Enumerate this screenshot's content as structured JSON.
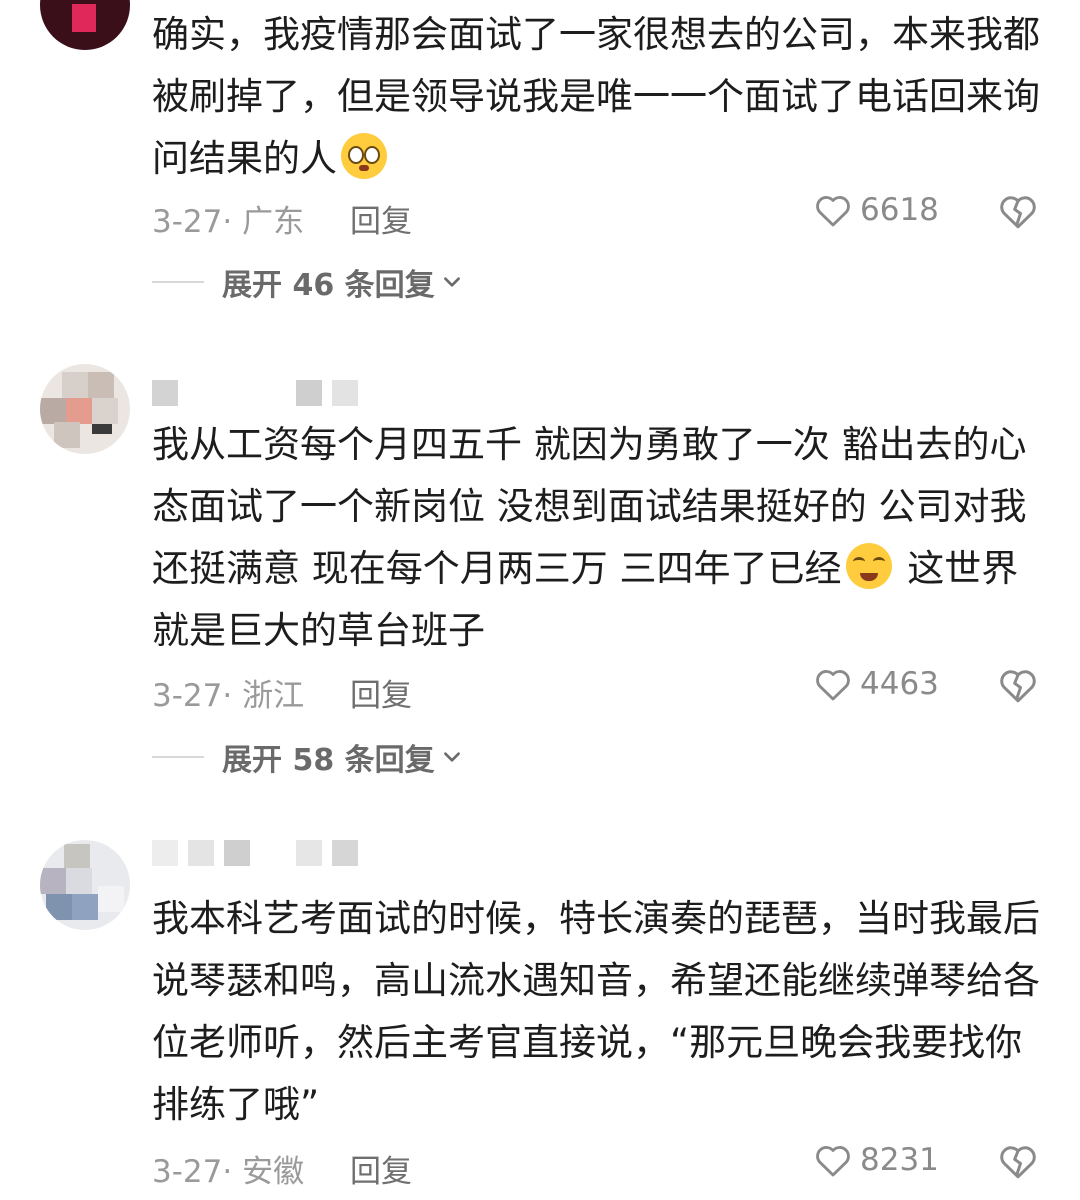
{
  "comments": [
    {
      "text_lines": [
        "确实，我疫情那会面试了一家很想去的公司，本来我都",
        "被刷掉了，但是领导说我是唯一一个面试了电话回来询",
        "问结果的人"
      ],
      "emoji": "pleading-face-icon",
      "date": "3-27",
      "location_prefix": "·",
      "location": "广东",
      "reply_label": "回复",
      "likes": "6618",
      "expand_label": "展开 46 条回复"
    },
    {
      "text_lines": [
        "我从工资每个月四五千 就因为勇敢了一次 豁出去的心",
        "态面试了一个新岗位 没想到面试结果挺好的 公司对我",
        "还挺满意 现在每个月两三万 三四年了已经",
        "就是巨大的草台班子"
      ],
      "emoji": "rolling-laughing-icon",
      "after_emoji": " 这世界",
      "date": "3-27",
      "location_prefix": "·",
      "location": "浙江",
      "reply_label": "回复",
      "likes": "4463",
      "expand_label": "展开 58 条回复"
    },
    {
      "text_lines": [
        "我本科艺考面试的时候，特长演奏的琵琶，当时我最后",
        "说琴瑟和鸣，高山流水遇知音，希望还能继续弹琴给各",
        "位老师听，然后主考官直接说，“那元旦晚会我要找你",
        "排练了哦”"
      ],
      "date": "3-27",
      "location_prefix": "·",
      "location": "安徽",
      "reply_label": "回复",
      "likes": "8231"
    }
  ],
  "colors": {
    "text": "#1d1d1d",
    "meta": "#9a9a9a",
    "expand": "#6a6a6a"
  }
}
